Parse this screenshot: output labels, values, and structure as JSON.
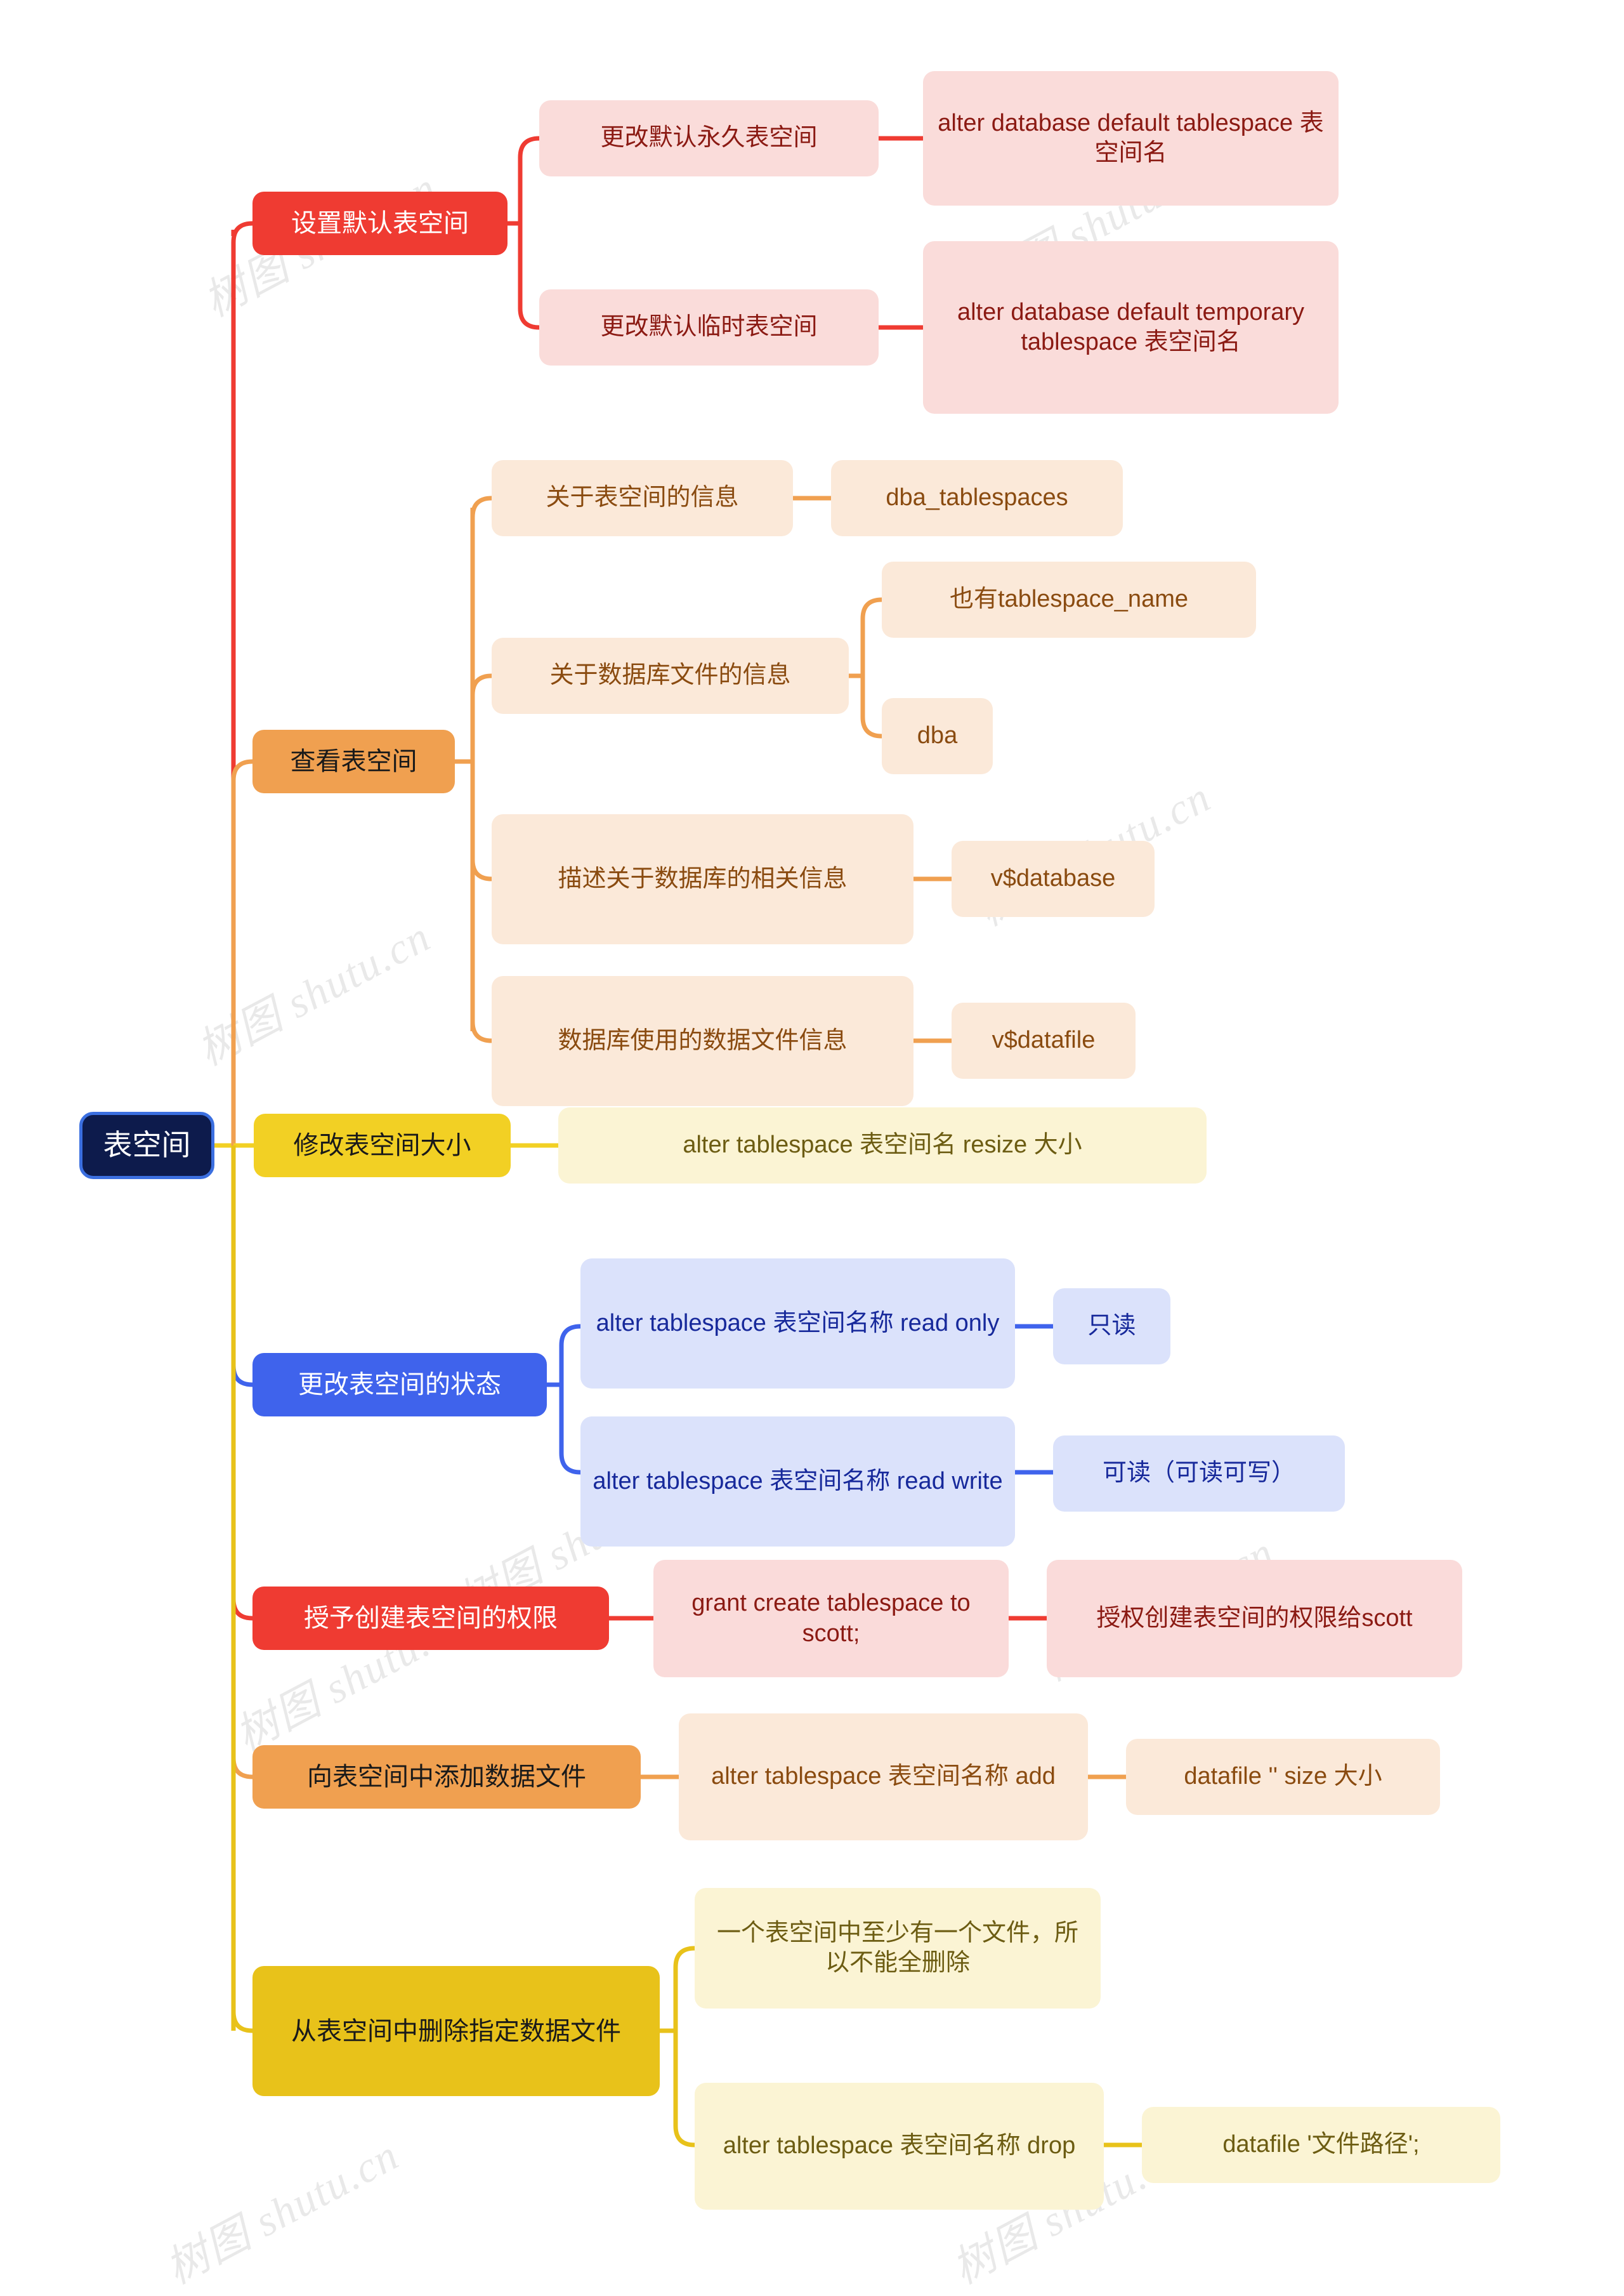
{
  "mindmap": {
    "root": {
      "label": "表空间"
    },
    "branches": [
      {
        "label": "设置默认表空间",
        "color": "#ef3b32",
        "children": [
          {
            "label": "更改默认永久表空间",
            "children": [
              {
                "label": "alter database default tablespace 表空间名"
              }
            ]
          },
          {
            "label": "更改默认临时表空间",
            "children": [
              {
                "label": "alter database default temporary tablespace 表空间名"
              }
            ]
          }
        ]
      },
      {
        "label": "查看表空间",
        "color": "#f0a050",
        "children": [
          {
            "label": "关于表空间的信息",
            "children": [
              {
                "label": "dba_tablespaces"
              }
            ]
          },
          {
            "label": "关于数据库文件的信息",
            "children": [
              {
                "label": "也有tablespace_name"
              },
              {
                "label": "dba"
              }
            ]
          },
          {
            "label": "描述关于数据库的相关信息",
            "children": [
              {
                "label": "v$database"
              }
            ]
          },
          {
            "label": "数据库使用的数据文件信息",
            "children": [
              {
                "label": "v$datafile"
              }
            ]
          }
        ]
      },
      {
        "label": "修改表空间大小",
        "color": "#f2d024",
        "children": [
          {
            "label": "alter tablespace 表空间名 resize 大小"
          }
        ]
      },
      {
        "label": "更改表空间的状态",
        "color": "#3f63ec",
        "children": [
          {
            "label": "alter tablespace 表空间名称 read only",
            "children": [
              {
                "label": "只读"
              }
            ]
          },
          {
            "label": "alter tablespace 表空间名称 read write",
            "children": [
              {
                "label": "可读（可读可写）"
              }
            ]
          }
        ]
      },
      {
        "label": "授予创建表空间的权限",
        "color": "#ef3b32",
        "children": [
          {
            "label": "grant create tablespace to scott;",
            "children": [
              {
                "label": "授权创建表空间的权限给scott"
              }
            ]
          }
        ]
      },
      {
        "label": "向表空间中添加数据文件",
        "color": "#f0a050",
        "children": [
          {
            "label": "alter tablespace 表空间名称 add",
            "children": [
              {
                "label": "datafile '' size 大小"
              }
            ]
          }
        ]
      },
      {
        "label": "从表空间中删除指定数据文件",
        "color": "#e8c21a",
        "children": [
          {
            "label": "一个表空间中至少有一个文件，所以不能全删除"
          },
          {
            "label": "alter tablespace 表空间名称 drop",
            "children": [
              {
                "label": "datafile '文件路径';"
              }
            ]
          }
        ]
      }
    ]
  },
  "watermarks": [
    {
      "text": "树图 shutu.cn"
    },
    {
      "text": "树图 shutu.cn"
    },
    {
      "text": "树图 shutu.cn"
    },
    {
      "text": "树图 shutu.cn"
    },
    {
      "text": "树图 shutu.cn"
    },
    {
      "text": "树图 shutu.cn"
    },
    {
      "text": "树图 shutu.cn"
    },
    {
      "text": "树图 shutu.cn"
    },
    {
      "text": "树图 shutu.cn"
    }
  ]
}
